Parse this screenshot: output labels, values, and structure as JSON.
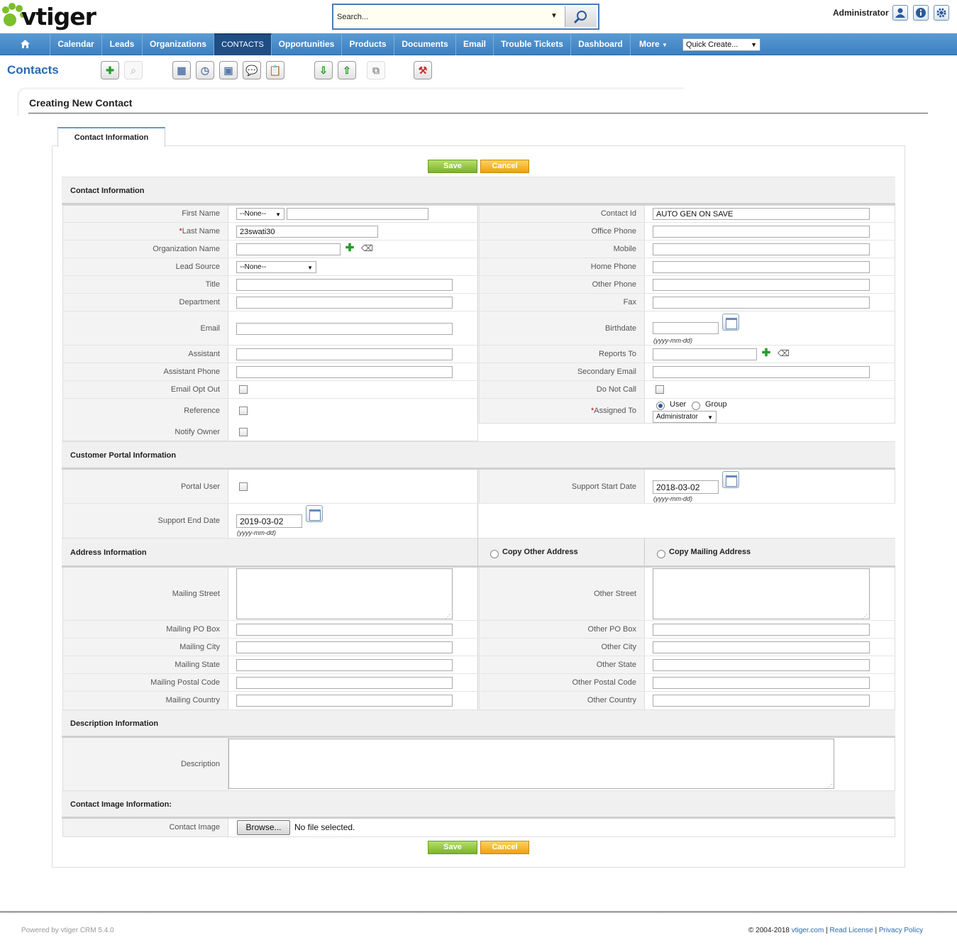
{
  "app": {
    "logo_text": "vtiger"
  },
  "search": {
    "placeholder": "Search...",
    "value": "Search..."
  },
  "header": {
    "user": "Administrator"
  },
  "nav": {
    "items": [
      "Calendar",
      "Leads",
      "Organizations",
      "CONTACTS",
      "Opportunities",
      "Products",
      "Documents",
      "Email",
      "Trouble Tickets",
      "Dashboard",
      "More"
    ],
    "active": "CONTACTS",
    "quick_create": "Quick Create..."
  },
  "module": {
    "title": "Contacts"
  },
  "panel": {
    "title": "Creating New Contact",
    "tab": "Contact Information"
  },
  "buttons": {
    "save": "Save",
    "cancel": "Cancel"
  },
  "sections": {
    "contact": "Contact Information",
    "portal": "Customer Portal Information",
    "address": "Address Information",
    "copy_other": "Copy Other Address",
    "copy_mailing": "Copy Mailing Address",
    "description": "Description Information",
    "image": "Contact Image Information:"
  },
  "fields": {
    "first_name": {
      "label": "First Name",
      "salutation": "--None--",
      "value": ""
    },
    "last_name": {
      "label": "Last Name",
      "required": "*",
      "value": "23swati30"
    },
    "organization_name": {
      "label": "Organization Name",
      "value": ""
    },
    "lead_source": {
      "label": "Lead Source",
      "value": "--None--"
    },
    "title": {
      "label": "Title",
      "value": ""
    },
    "department": {
      "label": "Department",
      "value": ""
    },
    "email": {
      "label": "Email",
      "value": ""
    },
    "assistant": {
      "label": "Assistant",
      "value": ""
    },
    "assistant_phone": {
      "label": "Assistant Phone",
      "value": ""
    },
    "email_opt_out": {
      "label": "Email Opt Out",
      "checked": false
    },
    "reference": {
      "label": "Reference",
      "checked": false
    },
    "notify_owner": {
      "label": "Notify Owner",
      "checked": false
    },
    "contact_id": {
      "label": "Contact Id",
      "value": "AUTO GEN ON SAVE"
    },
    "office_phone": {
      "label": "Office Phone",
      "value": ""
    },
    "mobile": {
      "label": "Mobile",
      "value": ""
    },
    "home_phone": {
      "label": "Home Phone",
      "value": ""
    },
    "other_phone": {
      "label": "Other Phone",
      "value": ""
    },
    "fax": {
      "label": "Fax",
      "value": ""
    },
    "birthdate": {
      "label": "Birthdate",
      "value": "",
      "hint": "(yyyy-mm-dd)"
    },
    "reports_to": {
      "label": "Reports To",
      "value": ""
    },
    "secondary_email": {
      "label": "Secondary Email",
      "value": ""
    },
    "do_not_call": {
      "label": "Do Not Call",
      "checked": false
    },
    "assigned_to": {
      "label": "Assigned To",
      "required": "*",
      "option_user": "User",
      "option_group": "Group",
      "value": "Administrator"
    },
    "portal_user": {
      "label": "Portal User",
      "checked": false
    },
    "support_start_date": {
      "label": "Support Start Date",
      "value": "2018-03-02",
      "hint": "(yyyy-mm-dd)"
    },
    "support_end_date": {
      "label": "Support End Date",
      "value": "2019-03-02",
      "hint": "(yyyy-mm-dd)"
    },
    "mailing_street": {
      "label": "Mailing Street",
      "value": ""
    },
    "other_street": {
      "label": "Other Street",
      "value": ""
    },
    "mailing_po_box": {
      "label": "Mailing PO Box",
      "value": ""
    },
    "other_po_box": {
      "label": "Other PO Box",
      "value": ""
    },
    "mailing_city": {
      "label": "Mailing City",
      "value": ""
    },
    "other_city": {
      "label": "Other City",
      "value": ""
    },
    "mailing_state": {
      "label": "Mailing State",
      "value": ""
    },
    "other_state": {
      "label": "Other State",
      "value": ""
    },
    "mailing_postal_code": {
      "label": "Mailing Postal Code",
      "value": ""
    },
    "other_postal_code": {
      "label": "Other Postal Code",
      "value": ""
    },
    "mailing_country": {
      "label": "Mailing Country",
      "value": ""
    },
    "other_country": {
      "label": "Other Country",
      "value": ""
    },
    "description": {
      "label": "Description",
      "value": ""
    },
    "contact_image": {
      "label": "Contact Image",
      "browse": "Browse...",
      "status": "No file selected."
    }
  },
  "footer": {
    "powered_by": "Powered by vtiger CRM 5.4.0",
    "copyright": "© 2004-2018",
    "link_site": "vtiger.com",
    "sep1": "|",
    "link_license": "Read License",
    "sep2": "|",
    "link_privacy": "Privacy Policy"
  },
  "colors": {
    "nav": "#3d7fc0",
    "nav_active": "#1f4e85",
    "title": "#2a6ab0",
    "save": "#7bb22c",
    "cancel": "#e9a312",
    "required": "#cc0000"
  },
  "icons": [
    "home-icon",
    "search-icon",
    "user-icon",
    "info-icon",
    "gear-icon",
    "create-icon",
    "search-tool-icon",
    "calendar-icon",
    "clock-icon",
    "calculator-icon",
    "chat-icon",
    "clipboard-icon",
    "import-icon",
    "export-icon",
    "find-duplicates-icon",
    "settings-tool-icon",
    "plus-icon",
    "eraser-icon"
  ]
}
